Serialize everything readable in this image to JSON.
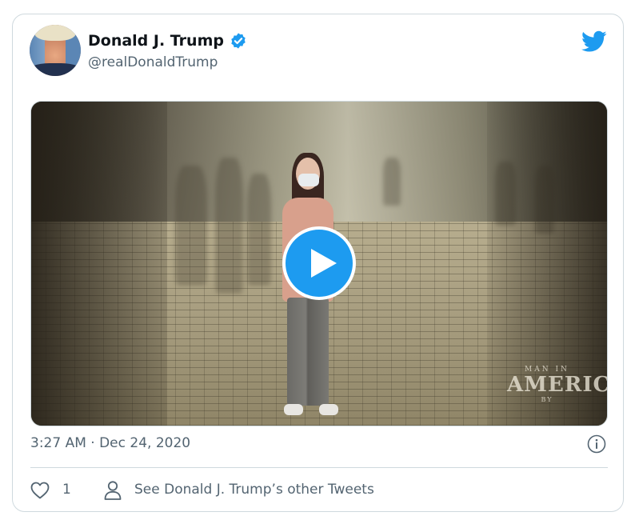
{
  "author": {
    "name": "Donald J. Trump",
    "handle": "@realDonaldTrump",
    "verified": true
  },
  "media": {
    "type": "video",
    "watermark": {
      "top": "MAN IN",
      "main": "AMERICA",
      "bottom": "BY"
    }
  },
  "timestamp": "3:27 AM · Dec 24, 2020",
  "actions": {
    "like_count": "1",
    "other_tweets_label": "See Donald J. Trump’s other Tweets"
  },
  "colors": {
    "brand_blue": "#1d9bf0",
    "text_secondary": "#536471",
    "border": "#cfd9de"
  },
  "icons": [
    "twitter-bird-icon",
    "verified-badge-icon",
    "play-icon",
    "info-icon",
    "heart-icon",
    "person-icon"
  ]
}
